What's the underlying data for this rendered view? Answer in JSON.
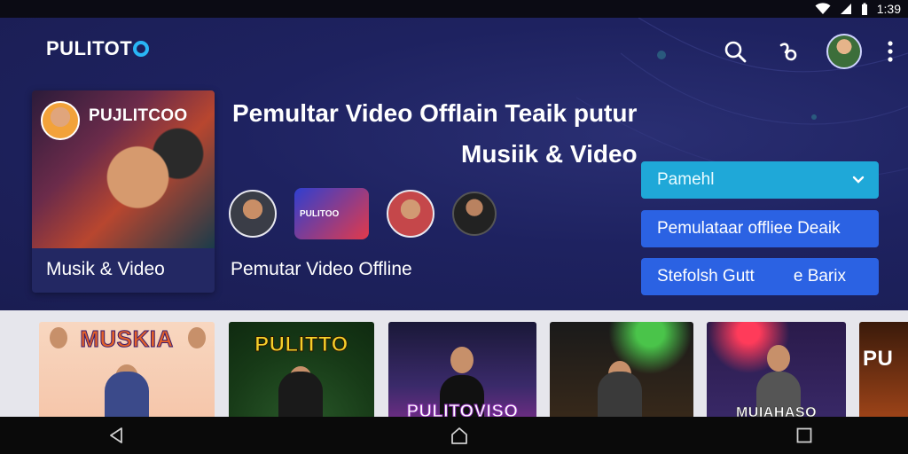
{
  "status_bar": {
    "time": "1:39"
  },
  "header": {
    "logo_text": "PULITOT",
    "actions": [
      {
        "icon": "search-icon"
      },
      {
        "icon": "cast-icon"
      },
      {
        "icon": "profile-avatar"
      },
      {
        "icon": "more-vert-icon"
      }
    ]
  },
  "featured": {
    "thumb_title": "PUJLITCOO",
    "label": "Musik & Video"
  },
  "hero": {
    "title_line1": "Pemultar Video Offlain Teaik putur",
    "title_line2": "Musiik & Video",
    "subtitle": "Pemutar Video Offline",
    "avatar_badge_text": "PULITOO",
    "select_label": "Pamehl",
    "button_1": "Pemulataar offliee Deaik",
    "button_2_left": "Stefolsh Gutt",
    "button_2_right": "e Barix"
  },
  "videos": [
    {
      "title": "MUSKIA"
    },
    {
      "title": "PULITTO"
    },
    {
      "title": "PULITOVISO"
    },
    {
      "title": ""
    },
    {
      "title": "MUIAHASO"
    },
    {
      "title": "PU"
    }
  ],
  "colors": {
    "hero_bg": "#1e2260",
    "accent_cyan": "#1fa8d8",
    "accent_blue": "#2b62e3",
    "strip_bg": "#e6e6ec"
  }
}
